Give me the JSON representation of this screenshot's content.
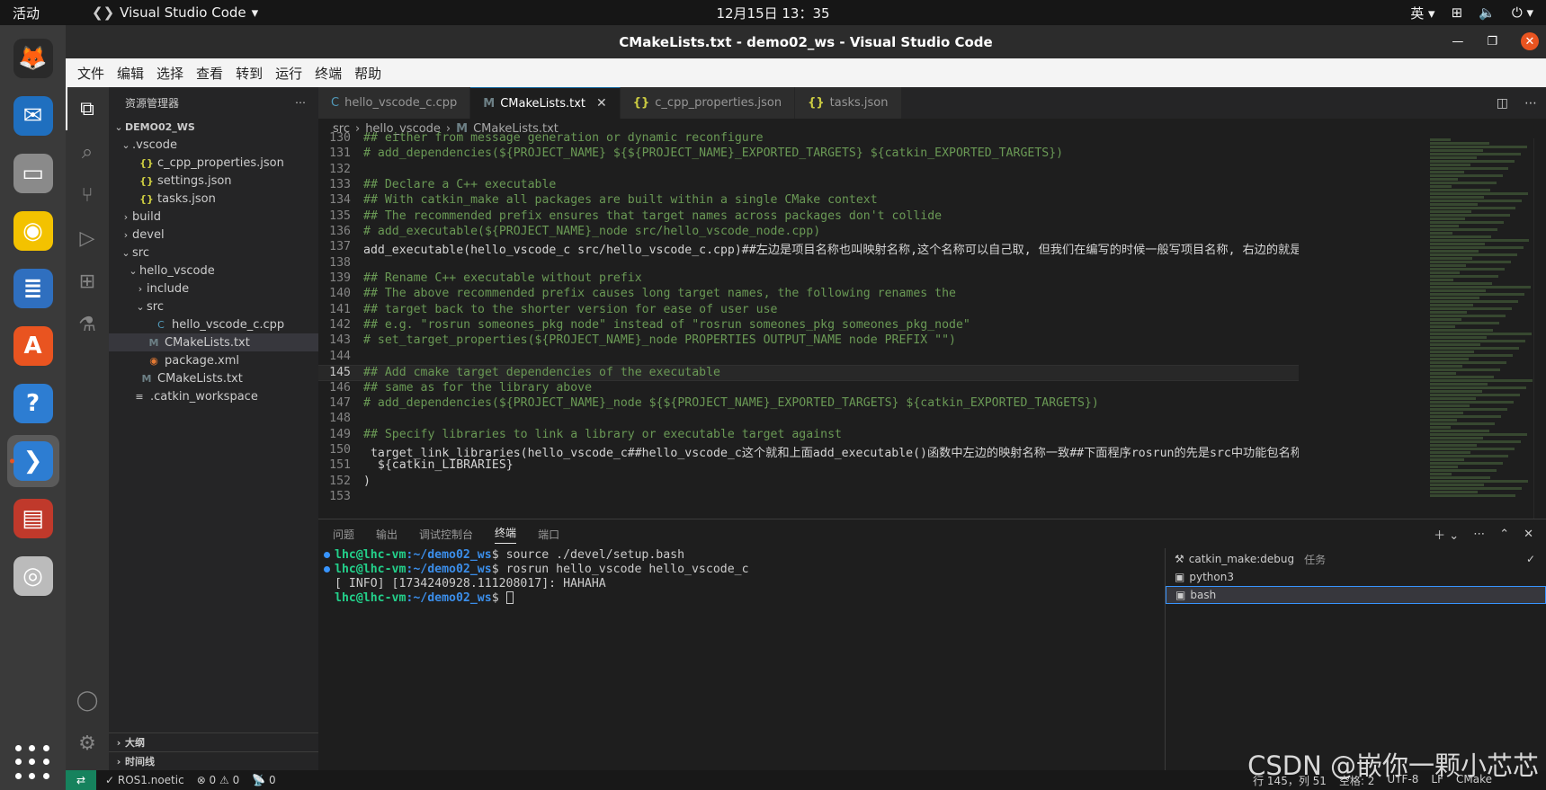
{
  "topbar": {
    "activities": "活动",
    "app_name": "Visual Studio Code",
    "clock": "12月15日  13：35",
    "input_method": "英"
  },
  "dock": {
    "items": [
      {
        "name": "firefox-icon",
        "glyph": "🦊",
        "bg": "#2a2a2a"
      },
      {
        "name": "thunderbird-icon",
        "glyph": "✉",
        "bg": "#1f6fbf"
      },
      {
        "name": "files-icon",
        "glyph": "▭",
        "bg": "#8a8a8a"
      },
      {
        "name": "rhythmbox-icon",
        "glyph": "◉",
        "bg": "#f3c200"
      },
      {
        "name": "writer-icon",
        "glyph": "≣",
        "bg": "#2f6fbf"
      },
      {
        "name": "software-icon",
        "glyph": "A",
        "bg": "#e95420"
      },
      {
        "name": "help-icon",
        "glyph": "?",
        "bg": "#2d7dd2"
      },
      {
        "name": "vscode-icon",
        "glyph": "❯",
        "bg": "#2d7dd2",
        "active": true
      },
      {
        "name": "terminal-app-icon",
        "glyph": "▤",
        "bg": "#c0392b"
      },
      {
        "name": "dvd-icon",
        "glyph": "◎",
        "bg": "#bbbbbb"
      }
    ]
  },
  "window": {
    "title": "CMakeLists.txt - demo02_ws - Visual Studio Code",
    "menu": [
      "文件",
      "编辑",
      "选择",
      "查看",
      "转到",
      "运行",
      "终端",
      "帮助"
    ]
  },
  "sidebar": {
    "title": "资源管理器",
    "root": "DEMO02_WS",
    "tree": [
      {
        "indent": 0,
        "chev": "⌄",
        "icon": "",
        "label": ".vscode"
      },
      {
        "indent": 1,
        "chev": "",
        "icon": "{}",
        "iconType": "json",
        "label": "c_cpp_properties.json"
      },
      {
        "indent": 1,
        "chev": "",
        "icon": "{}",
        "iconType": "json",
        "label": "settings.json"
      },
      {
        "indent": 1,
        "chev": "",
        "icon": "{}",
        "iconType": "json",
        "label": "tasks.json"
      },
      {
        "indent": 0,
        "chev": "›",
        "icon": "",
        "label": "build"
      },
      {
        "indent": 0,
        "chev": "›",
        "icon": "",
        "label": "devel"
      },
      {
        "indent": 0,
        "chev": "⌄",
        "icon": "",
        "label": "src"
      },
      {
        "indent": 1,
        "chev": "⌄",
        "icon": "",
        "label": "hello_vscode"
      },
      {
        "indent": 2,
        "chev": "›",
        "icon": "",
        "label": "include"
      },
      {
        "indent": 2,
        "chev": "⌄",
        "icon": "",
        "label": "src"
      },
      {
        "indent": 3,
        "chev": "",
        "icon": "C",
        "iconType": "cpp",
        "label": "hello_vscode_c.cpp"
      },
      {
        "indent": 2,
        "chev": "",
        "icon": "M",
        "iconType": "m",
        "label": "CMakeLists.txt",
        "selected": true
      },
      {
        "indent": 2,
        "chev": "",
        "icon": "◉",
        "iconType": "rss",
        "label": "package.xml"
      },
      {
        "indent": 1,
        "chev": "",
        "icon": "M",
        "iconType": "m",
        "label": "CMakeLists.txt"
      },
      {
        "indent": 0,
        "chev": "",
        "icon": "≡",
        "iconType": "plain",
        "label": ".catkin_workspace"
      }
    ],
    "outline": "大纲",
    "timeline": "时间线"
  },
  "editor": {
    "tabs": [
      {
        "icon": "C",
        "label": "hello_vscode_c.cpp",
        "active": false
      },
      {
        "icon": "M",
        "label": "CMakeLists.txt",
        "active": true
      },
      {
        "icon": "{}",
        "label": "c_cpp_properties.json",
        "active": false
      },
      {
        "icon": "{}",
        "label": "tasks.json",
        "active": false
      }
    ],
    "breadcrumb": [
      "src",
      "hello_vscode",
      "CMakeLists.txt"
    ],
    "current_line": 145,
    "lines": [
      {
        "n": "130",
        "t": "## either from message generation or dynamic reconfigure"
      },
      {
        "n": "131",
        "t": "# add_dependencies(${PROJECT_NAME} ${${PROJECT_NAME}_EXPORTED_TARGETS} ${catkin_EXPORTED_TARGETS})"
      },
      {
        "n": "132",
        "t": ""
      },
      {
        "n": "133",
        "t": "## Declare a C++ executable"
      },
      {
        "n": "134",
        "t": "## With catkin_make all packages are built within a single CMake context"
      },
      {
        "n": "135",
        "t": "## The recommended prefix ensures that target names across packages don't collide"
      },
      {
        "n": "136",
        "t": "# add_executable(${PROJECT_NAME}_node src/hello_vscode_node.cpp)"
      },
      {
        "n": "137",
        "t": "add_executable(hello_vscode_c src/hello_vscode_c.cpp)##左边是项目名称也叫映射名称,这个名称可以自己取, 但我们在编写的时候一般写项目名称, 右边的就是.cpp文件"
      },
      {
        "n": "138",
        "t": ""
      },
      {
        "n": "139",
        "t": "## Rename C++ executable without prefix"
      },
      {
        "n": "140",
        "t": "## The above recommended prefix causes long target names, the following renames the"
      },
      {
        "n": "141",
        "t": "## target back to the shorter version for ease of user use"
      },
      {
        "n": "142",
        "t": "## e.g. \"rosrun someones_pkg node\" instead of \"rosrun someones_pkg someones_pkg_node\""
      },
      {
        "n": "143",
        "t": "# set_target_properties(${PROJECT_NAME}_node PROPERTIES OUTPUT_NAME node PREFIX \"\")"
      },
      {
        "n": "144",
        "t": ""
      },
      {
        "n": "145",
        "t": "## Add cmake target dependencies of the executable"
      },
      {
        "n": "146",
        "t": "## same as for the library above"
      },
      {
        "n": "147",
        "t": "# add_dependencies(${PROJECT_NAME}_node ${${PROJECT_NAME}_EXPORTED_TARGETS} ${catkin_EXPORTED_TARGETS})"
      },
      {
        "n": "148",
        "t": ""
      },
      {
        "n": "149",
        "t": "## Specify libraries to link a library or executable target against"
      },
      {
        "n": "150",
        "t": " target_link_libraries(hello_vscode_c##hello_vscode_c这个就和上面add_executable()函数中左边的映射名称一致##下面程序rosrun的先是src中功能包名称#hello_vscode"
      },
      {
        "n": "151",
        "t": "  ${catkin_LIBRARIES}"
      },
      {
        "n": "152",
        "t": ")"
      },
      {
        "n": "153",
        "t": ""
      }
    ]
  },
  "panel": {
    "tabs": [
      "问题",
      "输出",
      "调试控制台",
      "终端",
      "端口"
    ],
    "active_tab": "终端",
    "terminal_lines": [
      {
        "dot": true,
        "user": "lhc@lhc-vm",
        "path": ":~/demo02_ws",
        "cmd": "$ source ./devel/setup.bash"
      },
      {
        "dot": true,
        "user": "lhc@lhc-vm",
        "path": ":~/demo02_ws",
        "cmd": "$ rosrun hello_vscode hello_vscode_c"
      },
      {
        "dot": false,
        "plain": "[ INFO] [1734240928.111208017]: HAHAHA"
      },
      {
        "dot": false,
        "user": "lhc@lhc-vm",
        "path": ":~/demo02_ws",
        "cmd": "$ ",
        "cursor": true
      }
    ],
    "terminals": [
      {
        "label": "catkin_make:debug",
        "sub": "任务",
        "icon": "⚒",
        "check": true
      },
      {
        "label": "python3",
        "sub": "",
        "icon": "▣"
      },
      {
        "label": "bash",
        "sub": "",
        "icon": "▣",
        "selected": true
      }
    ]
  },
  "statusbar": {
    "ros": "✓ ROS1.noetic",
    "problems": "⊗ 0 ⚠ 0",
    "ports": "📡 0",
    "position": "行 145，列 51",
    "spaces": "空格: 2",
    "encoding": "UTF-8",
    "eol": "LF",
    "lang": "CMake"
  },
  "watermark": "CSDN @嵌你一颗小芯芯"
}
